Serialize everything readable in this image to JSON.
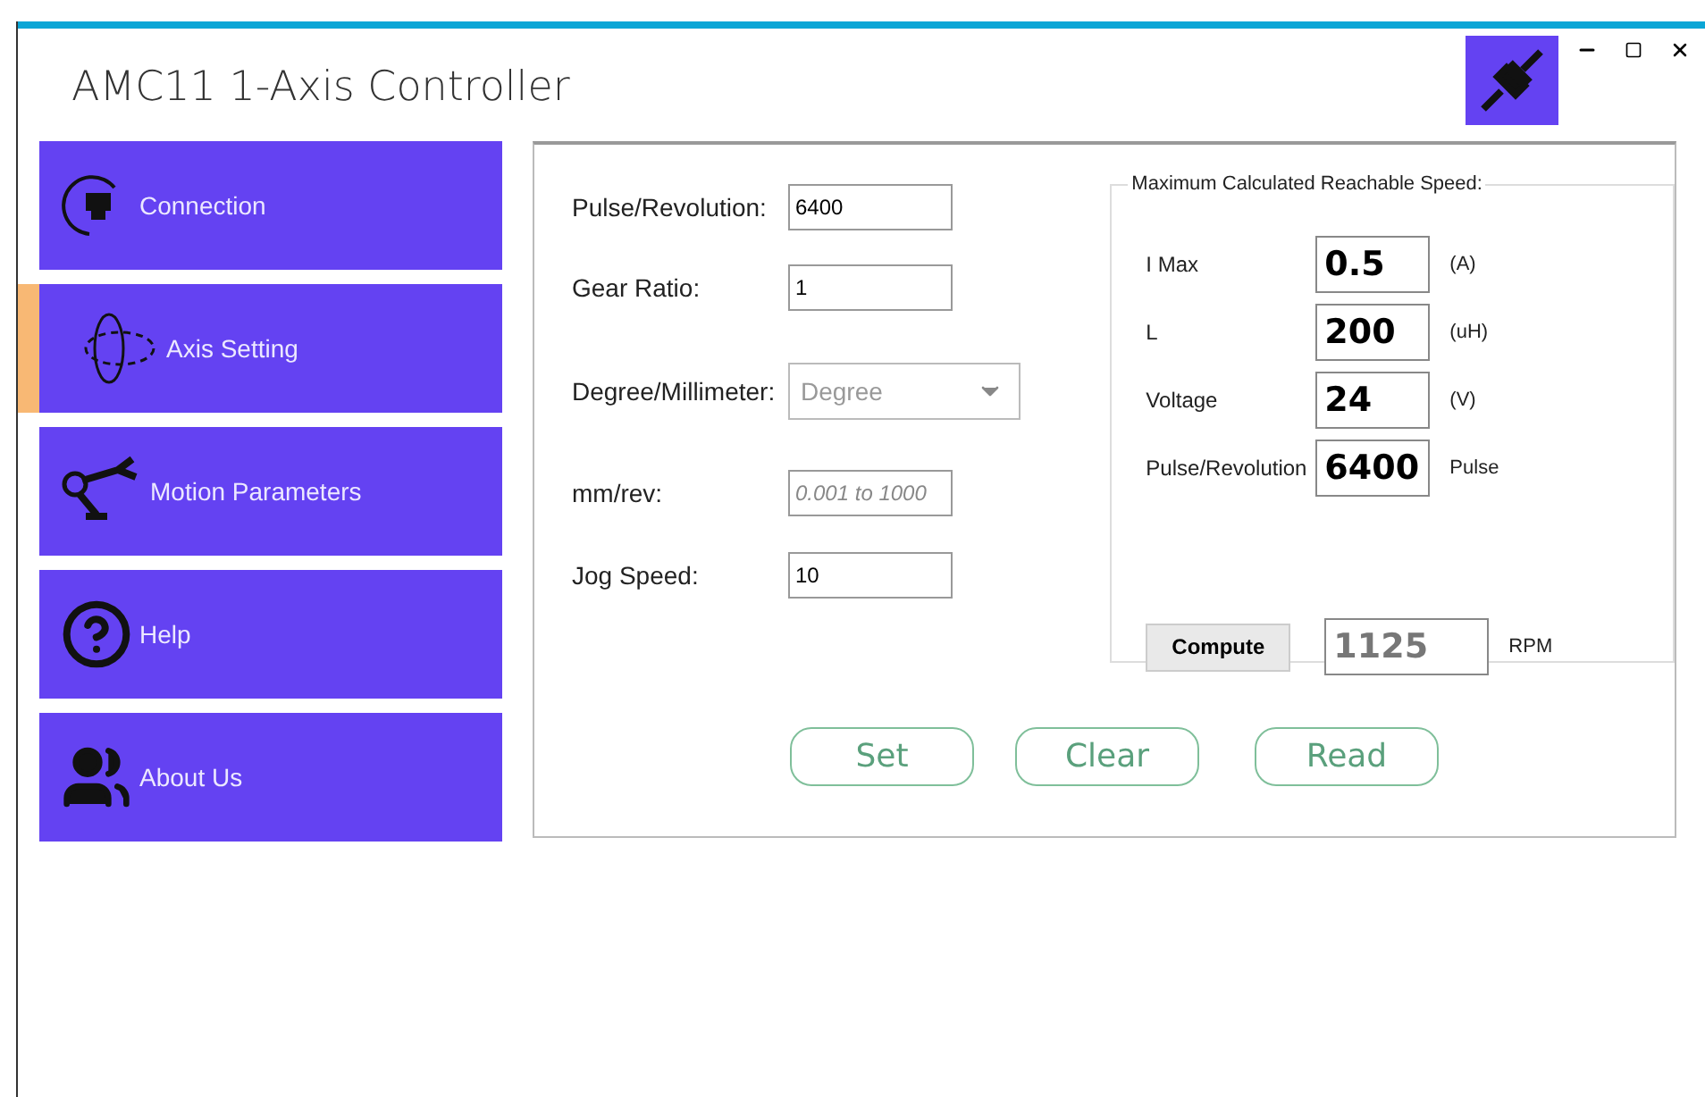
{
  "window": {
    "title": "AMC11 1-Axis Controller"
  },
  "sidebar": {
    "items": [
      {
        "label": "Connection",
        "selected": false
      },
      {
        "label": "Axis Setting",
        "selected": true
      },
      {
        "label": "Motion Parameters",
        "selected": false
      },
      {
        "label": "Help",
        "selected": false
      },
      {
        "label": "About Us",
        "selected": false
      }
    ]
  },
  "form": {
    "fields": [
      {
        "label": "Pulse/Revolution:",
        "kind": "text",
        "value": "6400"
      },
      {
        "label": "Gear Ratio:",
        "kind": "text",
        "value": "1"
      },
      {
        "label": "Degree/Millimeter:",
        "kind": "select",
        "value": "Degree",
        "disabled": true
      },
      {
        "label": "mm/rev:",
        "kind": "text",
        "placeholder": "0.001 to 1000"
      },
      {
        "label": "Jog Speed:",
        "kind": "text",
        "value": "10"
      }
    ]
  },
  "speed_panel": {
    "title": "Maximum Calculated Reachable Speed:",
    "rows": [
      {
        "label": "I Max",
        "value": "0.5",
        "unit": "(A)"
      },
      {
        "label": "L",
        "value": "200",
        "unit": "(uH)"
      },
      {
        "label": "Voltage",
        "value": "24",
        "unit": "(V)"
      },
      {
        "label": "Pulse/Revolution",
        "value": "6400",
        "unit": "Pulse"
      }
    ],
    "compute_button": "Compute",
    "result": {
      "value": "1125",
      "disabled": true
    },
    "result_unit": "RPM"
  },
  "buttons": [
    "Set",
    "Clear",
    "Read"
  ]
}
